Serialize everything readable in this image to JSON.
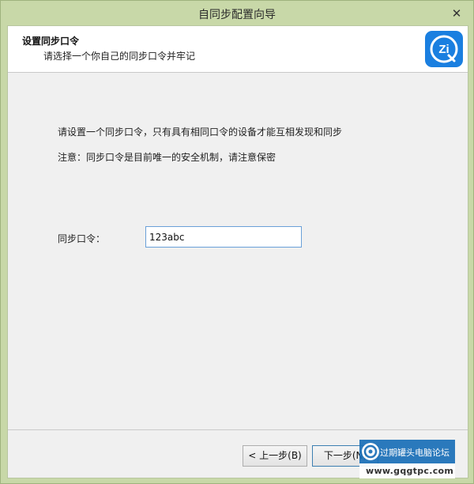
{
  "window": {
    "title": "自同步配置向导",
    "close_glyph": "✕"
  },
  "header": {
    "title": "设置同步口令",
    "subtitle": "请选择一个你自己的同步口令并牢记",
    "logo_icon": "zi-sync-logo"
  },
  "main": {
    "description_1": "请设置一个同步口令，只有具有相同口令的设备才能互相发现和同步",
    "description_2": "注意：同步口令是目前唯一的安全机制，请注意保密",
    "field_label": "同步口令：",
    "field_value": "123abc"
  },
  "footer": {
    "prev_label": "< 上一步(B)",
    "next_label": "下一步(N)"
  },
  "watermark": {
    "text": "过期罐头电脑论坛",
    "url": "www.gqgtpc.com"
  },
  "colors": {
    "titlebar": "#c8d8a8",
    "accent": "#1a7fe0",
    "input_border": "#6aa0d8"
  }
}
